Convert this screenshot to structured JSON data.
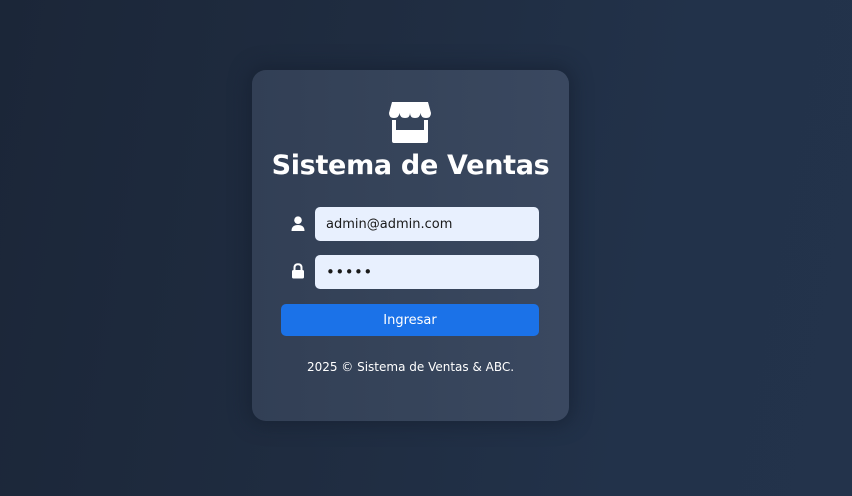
{
  "login": {
    "title": "Sistema de Ventas",
    "logo_icon": "store-icon",
    "user_icon": "user-icon",
    "lock_icon": "lock-icon",
    "email_value": "admin@admin.com",
    "password_value": "admin",
    "submit_label": "Ingresar",
    "footer": "2025 © Sistema de Ventas & ABC."
  },
  "colors": {
    "background": "#1f2c40",
    "card": "#36445a",
    "input_fill": "#e8f0fe",
    "button": "#1b72e8",
    "text": "#ffffff"
  }
}
